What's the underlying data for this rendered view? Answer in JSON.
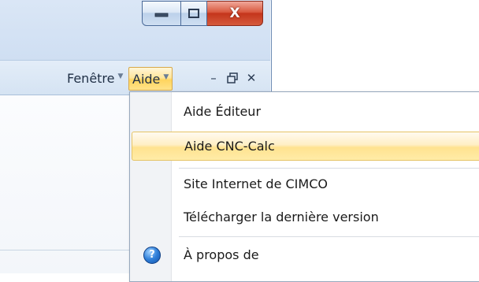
{
  "window": {
    "title_buttons": {
      "minimize_icon": "minimize-icon",
      "maximize_icon": "maximize-icon",
      "close_icon": "close-icon",
      "close_glyph": "X"
    }
  },
  "menubar": {
    "items": [
      {
        "label": "Fenêtre",
        "arrow": "▼"
      },
      {
        "label": "Aide",
        "arrow": "▼"
      }
    ],
    "mdi_controls": {
      "minimize": "–",
      "restore": "🗗",
      "close": "✕"
    }
  },
  "dropdown": {
    "items": [
      {
        "label": "Aide Éditeur"
      },
      {
        "label": "Aide CNC-Calc"
      },
      {
        "label": "Site Internet de CIMCO"
      },
      {
        "label": "Télécharger la dernière version"
      },
      {
        "label": "À propos de",
        "icon": "help-icon",
        "icon_glyph": "?"
      }
    ]
  },
  "colors": {
    "highlight": "#ffe28f",
    "close_button": "#c4351c"
  }
}
